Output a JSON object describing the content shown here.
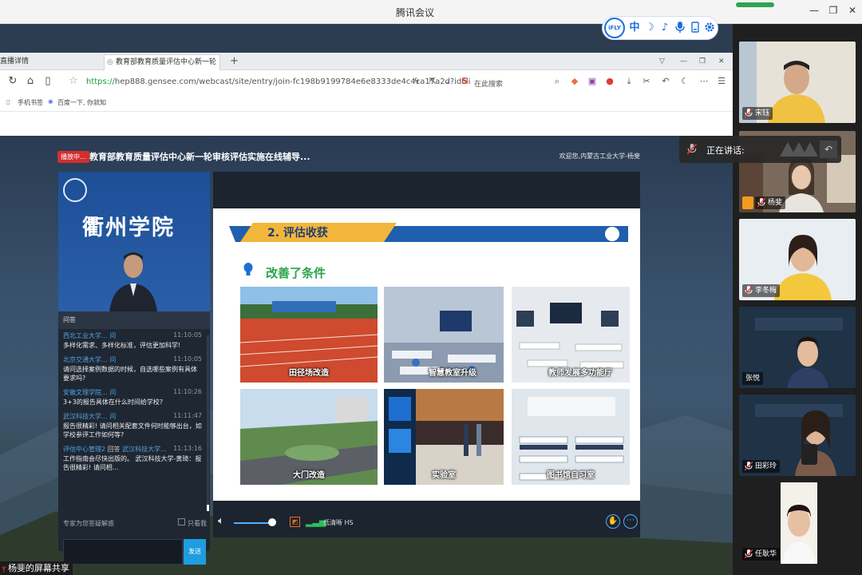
{
  "meeting": {
    "title": "腾讯会议",
    "window_controls": [
      "—",
      "❐",
      "✕"
    ],
    "signal_color": "#2ea44f",
    "share_label": "杨斐的屏幕共享"
  },
  "ifly_toolbar": {
    "logo": "iFLY",
    "items": [
      "中",
      "☽",
      "♪",
      "🎤",
      "▯",
      "⚙"
    ]
  },
  "browser": {
    "tabs": [
      {
        "label": "直播详情",
        "active": false
      },
      {
        "label": "教育部教育质量评估中心新一轮",
        "active": true
      }
    ],
    "new_tab": "+",
    "url_scheme": "https://",
    "url_rest": "hep888.gensee.com/webcast/site/entry/join-fc198b9199784e6e8333de4c4ca17a2d?idcli",
    "search_placeholder": "在此搜索",
    "bookmarks": [
      "手机书签",
      "百度一下, 你就知"
    ]
  },
  "webcast": {
    "live_badge": "播放中...",
    "title": "教育部教育质量评估中心新一轮审核评估实施在线辅导...",
    "welcome": "欢迎您,内蒙古工业大学-杨斐",
    "camera_school_name": "衢州学院",
    "qa_header": "问答",
    "qa_items": [
      {
        "user": "西北工业大学...",
        "tag": "问",
        "time": "11:10:05",
        "text": "多样化需求、多样化标准，评估更加科学!"
      },
      {
        "user": "北京交通大学...",
        "tag": "问",
        "time": "11:10:05",
        "text": "请问选择案例数据的时候，自选哪些案例有具体要求吗?"
      },
      {
        "user": "安徽文理学院...",
        "tag": "问",
        "time": "11:10:26",
        "text": "3+3的报告具体在什么时间给学校?"
      },
      {
        "user": "武汉科技大学...",
        "tag": "问",
        "time": "11:11:47",
        "text": "报告很精彩! 请问相关配套文件何时能够出台，如学校参评工作如何等?"
      },
      {
        "user": "评估中心管理2",
        "tag": "回答",
        "user2": "武汉科技大学...",
        "time": "11:13:16",
        "text": "工作指南会尽快出版的。 武汉科技大学-黄琦：报告很精彩! 请问相..."
      }
    ],
    "expert_filter": "专家为您答疑解惑",
    "only_me": "只看我",
    "send": "发送",
    "quality": "低清晰 HS"
  },
  "slide": {
    "section_title": "2. 评估收获",
    "subheading": "改善了条件",
    "photos": [
      {
        "caption": "田径场改造"
      },
      {
        "caption": "智慧教室升级"
      },
      {
        "caption": "教师发展多功能厅"
      },
      {
        "caption": "大门改造"
      },
      {
        "caption": "实验室"
      },
      {
        "caption": "图书馆自习室"
      }
    ]
  },
  "participants": [
    {
      "name": "宋钰"
    },
    {
      "name": "杨斐"
    },
    {
      "name": "李冬梅"
    },
    {
      "name": "张悦"
    },
    {
      "name": "田彩玲"
    },
    {
      "name": "任耿华"
    }
  ],
  "speaking": {
    "label": "正在讲话:"
  }
}
